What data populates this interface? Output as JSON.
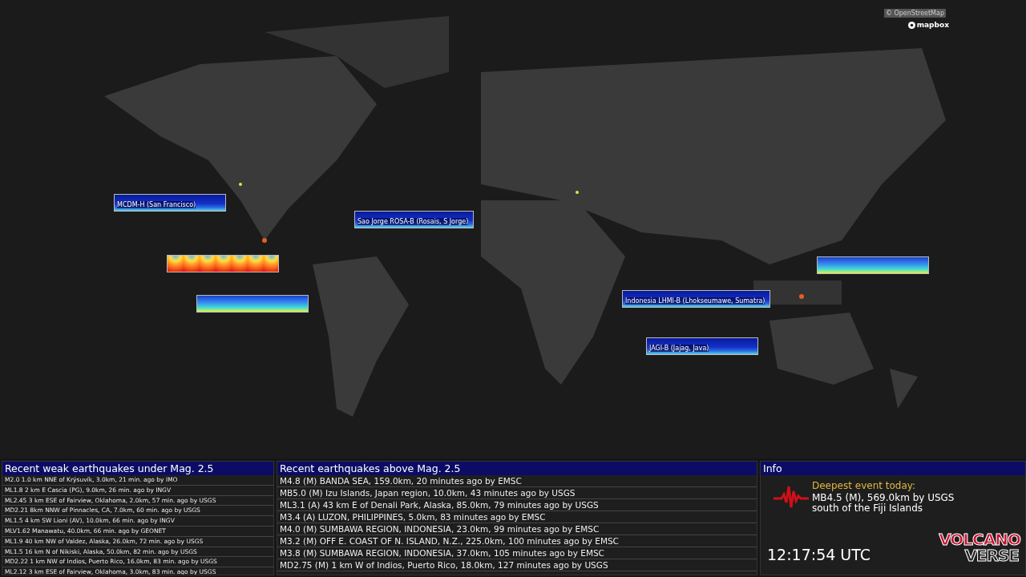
{
  "map": {
    "kind": "picture",
    "attribution": "© OpenStreetMap",
    "brand": "mapbox",
    "spectrograms": [
      {
        "label": "MCDM-H (San Francisco)",
        "kind": "plain"
      },
      {
        "label": "Sao Jorge ROSA-B (Rosais, S Jorge)",
        "kind": "plain"
      },
      {
        "kind": "heat"
      },
      {
        "kind": "jet"
      },
      {
        "label": "Indonesia LHMI-B (Lhokseumawe, Sumatra)",
        "kind": "plain"
      },
      {
        "label": "JAGI-B (Jajag, Java)",
        "kind": "plain"
      },
      {
        "kind": "jet"
      }
    ]
  },
  "weak": {
    "title": "Recent weak earthquakes under Mag. 2.5",
    "rows": [
      "M2.0 1.0 km NNE  of Krýsuvík, 3.0km, 21 min. ago by IMO",
      "ML1.8 2 km E Cascia (PG), 9.0km, 26 min. ago by INGV",
      "ML2.45 3 km ESE of Fairview, Oklahoma, 2.0km, 57 min. ago by USGS",
      "MD2.21 8km NNW of Pinnacles, CA, 7.0km, 60 min. ago by USGS",
      "ML1.5 4 km SW Lioni (AV), 10.0km, 66 min. ago by INGV",
      "MLV1.62 Manawatu, 40.0km, 66 min. ago by GEONET",
      "ML1.9 40 km NW of Valdez, Alaska, 26.0km, 72 min. ago by USGS",
      "ML1.5 16 km N of Nikiski, Alaska, 50.0km, 82 min. ago by USGS",
      "MD2.22 1 km NW of Indios, Puerto Rico, 16.0km, 83 min. ago by USGS",
      "ML2.12 3 km ESE of Fairview, Oklahoma, 3.0km, 83 min. ago by USGS"
    ]
  },
  "strong": {
    "title": "Recent earthquakes above Mag. 2.5",
    "rows": [
      "M4.8 (M) BANDA SEA, 159.0km, 20 minutes ago by EMSC",
      "MB5.0 (M) Izu Islands, Japan region, 10.0km, 43 minutes ago by USGS",
      "ML3.1 (A) 43 km E of Denali Park, Alaska, 85.0km, 79 minutes ago by USGS",
      "M3.4 (A) LUZON, PHILIPPINES, 5.0km, 83 minutes ago by EMSC",
      "M4.0 (M) SUMBAWA REGION, INDONESIA, 23.0km, 99 minutes ago by EMSC",
      "M3.2 (M) OFF E. COAST OF N. ISLAND, N.Z., 225.0km, 100 minutes ago by EMSC",
      "M3.8 (M) SUMBAWA REGION, INDONESIA, 37.0km, 105 minutes ago by EMSC",
      "MD2.75 (M) 1 km W of Indios, Puerto Rico, 18.0km, 127 minutes ago by USGS"
    ]
  },
  "info": {
    "title": "Info",
    "heading": "Deepest event today:",
    "lines": [
      "MB4.5 (M), 569.0km by USGS",
      "south of the Fiji Islands"
    ],
    "time": "12:17:54 UTC",
    "logo": [
      "VOLCANO",
      "VERSE"
    ]
  }
}
